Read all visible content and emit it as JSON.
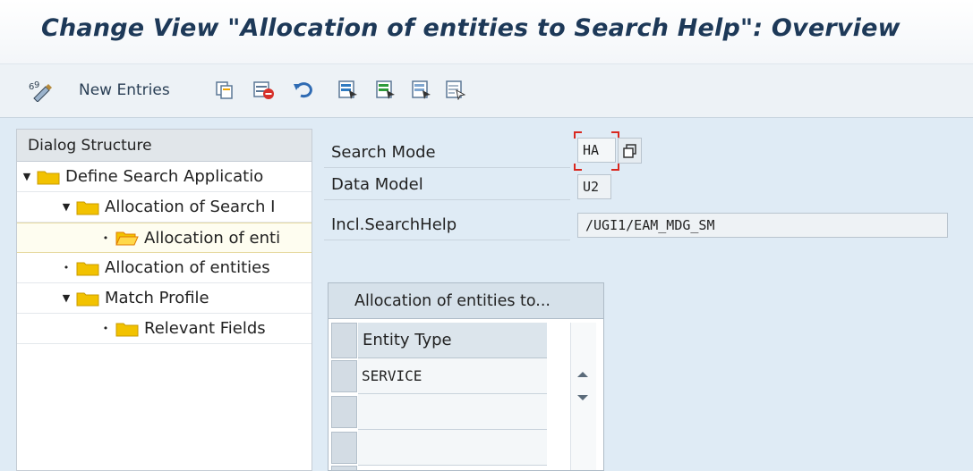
{
  "window": {
    "title": "Change View \"Allocation of entities to Search Help\": Overview"
  },
  "toolbar": {
    "display_change_icon": "glasses-pencil-icon",
    "new_entries_label": "New Entries",
    "icons": [
      "copy-icon",
      "delete-icon",
      "undo-icon",
      "select-all-icon",
      "select-block-icon",
      "deselect-all-icon",
      "details-icon"
    ]
  },
  "dialog_structure": {
    "header": "Dialog Structure",
    "items": [
      {
        "label": "Define Search Applicatio",
        "node": "expanded",
        "level": 0,
        "open": false
      },
      {
        "label": "Allocation of Search I",
        "node": "expanded",
        "level": 1,
        "open": false
      },
      {
        "label": "Allocation of enti",
        "node": "leaf",
        "level": 2,
        "open": true,
        "selected": true
      },
      {
        "label": "Allocation of entities",
        "node": "leaf",
        "level": 1,
        "open": false
      },
      {
        "label": "Match Profile",
        "node": "expanded",
        "level": 1,
        "open": false
      },
      {
        "label": "Relevant Fields",
        "node": "leaf",
        "level": 2,
        "open": false
      }
    ]
  },
  "fields": {
    "search_mode": {
      "label": "Search Mode",
      "value": "HA"
    },
    "data_model": {
      "label": "Data Model",
      "value": "U2"
    },
    "incl_search_help": {
      "label": "Incl.SearchHelp",
      "value": "/UGI1/EAM_MDG_SM"
    }
  },
  "table": {
    "title": "Allocation of entities to...",
    "column": "Entity Type",
    "rows": [
      "SERVICE",
      "",
      ""
    ],
    "settings_icon": "table-settings-icon"
  },
  "colors": {
    "accent": "#1d3958",
    "folder": "#f2c200",
    "background": "#dfebf5"
  }
}
